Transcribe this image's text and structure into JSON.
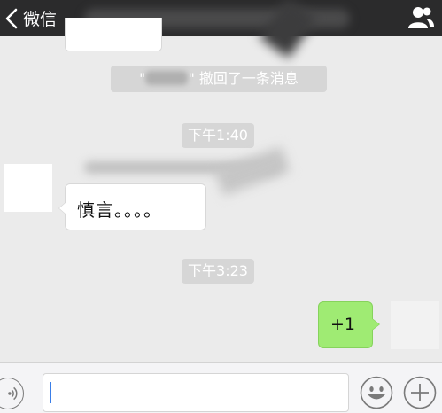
{
  "navbar": {
    "back_label": "微信",
    "icons": {
      "back": "chevron-left-icon",
      "contact": "contact-info-icon"
    }
  },
  "messages": {
    "recall_notice": {
      "prefix": "\"",
      "suffix": "\" 撤回了一条消息"
    },
    "time_1": "下午1:40",
    "incoming_text": "慎言。。。。",
    "time_2": "下午3:23",
    "outgoing_text": "+1"
  },
  "inputbar": {
    "icons": {
      "voice": "voice-icon",
      "emoji": "emoji-icon",
      "more": "plus-icon"
    }
  },
  "colors": {
    "navbar_bg": "#2b2b2c",
    "chat_bg": "#ebebeb",
    "outgoing_bubble": "#9feb73",
    "incoming_bubble": "#ffffff",
    "system_pill": "#d6d6d6",
    "caret": "#3a7ee8"
  }
}
